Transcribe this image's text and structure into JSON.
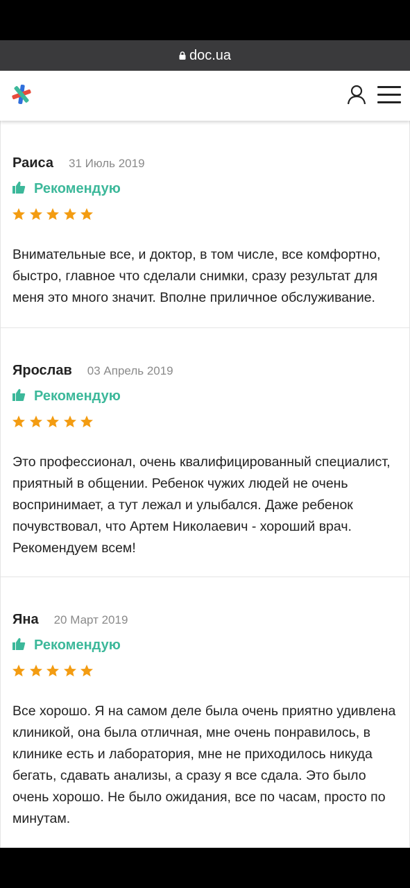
{
  "browser": {
    "url": "doc.ua"
  },
  "brand": {
    "accent": "#3cb89a",
    "star_color": "#f39c12"
  },
  "icons": {
    "lock": "lock-icon",
    "user": "user-icon",
    "menu": "hamburger-menu-icon",
    "thumb": "thumbs-up-icon",
    "star": "star-icon"
  },
  "reviews": [
    {
      "author": "Раиса",
      "date": "31 Июль 2019",
      "recommend": "Рекомендую",
      "rating": 5,
      "text": "Внимательные все, и доктор, в том числе, все комфортно, быстро, главное что сделали снимки, сразу результат для меня это много значит. Вполне приличное обслуживание."
    },
    {
      "author": "Ярослав",
      "date": "03 Апрель 2019",
      "recommend": "Рекомендую",
      "rating": 5,
      "text": "Это профессионал, очень квалифицированный специалист, приятный в общении. Ребенок чужих людей не очень воспринимает, а тут лежал и улыбался. Даже ребенок почувствовал, что Артем Николаевич - хороший врач. Рекомендуем всем!"
    },
    {
      "author": "Яна",
      "date": "20 Март 2019",
      "recommend": "Рекомендую",
      "rating": 5,
      "text": "Все хорошо. Я на самом деле была очень приятно удивлена клиникой, она была отличная, мне очень понравилось, в клинике есть и лаборатория, мне не приходилось никуда бегать, сдавать анализы, а сразу я все сдала. Это было очень хорошо. Не было ожидания, все по часам, просто по минутам."
    }
  ]
}
